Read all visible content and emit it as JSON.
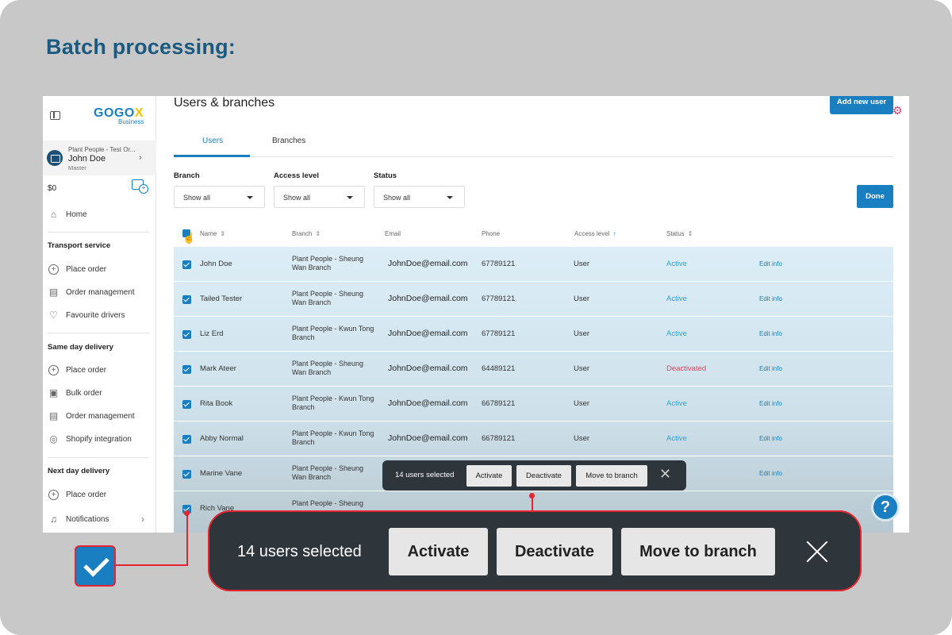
{
  "slide_title": "Batch processing:",
  "sidebar": {
    "logo": "GOGO",
    "logo_x": "X",
    "logo_sub": "Business",
    "account_org": "Plant People - Test Or...",
    "account_name": "John Doe",
    "account_role": "Master",
    "balance": "$0",
    "home": "Home",
    "sections": [
      {
        "title": "Transport service",
        "items": [
          "Place order",
          "Order management",
          "Favourite drivers"
        ]
      },
      {
        "title": "Same day delivery",
        "items": [
          "Place order",
          "Bulk order",
          "Order management",
          "Shopify integration"
        ]
      },
      {
        "title": "Next day delivery",
        "items": [
          "Place order",
          "Notifications"
        ]
      }
    ]
  },
  "main": {
    "title": "Users & branches",
    "add_button": "Add new user",
    "tabs": [
      "Users",
      "Branches"
    ],
    "filters": [
      {
        "label": "Branch",
        "value": "Show all"
      },
      {
        "label": "Access level",
        "value": "Show all"
      },
      {
        "label": "Status",
        "value": "Show all"
      }
    ],
    "done_button": "Done",
    "columns": [
      "Name",
      "Branch",
      "Email",
      "Phone",
      "Access level",
      "Status"
    ],
    "rows": [
      {
        "name": "John Doe",
        "branch": "Plant People - Sheung Wan Branch",
        "email": "JohnDoe@email.com",
        "phone": "67789121",
        "level": "User",
        "status": "Active",
        "edit": "Edit info"
      },
      {
        "name": "Tailed Tester",
        "branch": "Plant People - Sheung Wan Branch",
        "email": "JohnDoe@email.com",
        "phone": "67789121",
        "level": "User",
        "status": "Active",
        "edit": "Edit info"
      },
      {
        "name": "Liz Erd",
        "branch": "Plant People - Kwun Tong Branch",
        "email": "JohnDoe@email.com",
        "phone": "67789121",
        "level": "User",
        "status": "Active",
        "edit": "Edit info"
      },
      {
        "name": "Mark Ateer",
        "branch": "Plant People - Sheung Wan Branch",
        "email": "JohnDoe@email.com",
        "phone": "64489121",
        "level": "User",
        "status": "Deactivated",
        "edit": "Edit info"
      },
      {
        "name": "Rita Book",
        "branch": "Plant People - Kwun Tong Branch",
        "email": "JohnDoe@email.com",
        "phone": "66789121",
        "level": "User",
        "status": "Active",
        "edit": "Edit info"
      },
      {
        "name": "Abby Normal",
        "branch": "Plant People - Kwun Tong Branch",
        "email": "JohnDoe@email.com",
        "phone": "66789121",
        "level": "User",
        "status": "Active",
        "edit": "Edit info"
      },
      {
        "name": "Marine Vane",
        "branch": "Plant People - Sheung Wan Branch",
        "email": "",
        "phone": "",
        "level": "",
        "status": "",
        "edit": "Edit info"
      },
      {
        "name": "Rich Vane",
        "branch": "Plant People - Sheung",
        "email": "",
        "phone": "",
        "level": "",
        "status": "",
        "edit": ""
      }
    ],
    "batch_bar": {
      "selected": "14 users selected",
      "activate": "Activate",
      "deactivate": "Deactivate",
      "move": "Move to branch"
    },
    "help": "?"
  },
  "callout": {
    "selected": "14 users selected",
    "activate": "Activate",
    "deactivate": "Deactivate",
    "move": "Move to branch"
  },
  "colors": {
    "accent": "#1a7fc1",
    "active": "#2ea3c8",
    "deactivated": "#d9435b",
    "callout": "#e5252f",
    "bar": "#2e353b"
  }
}
